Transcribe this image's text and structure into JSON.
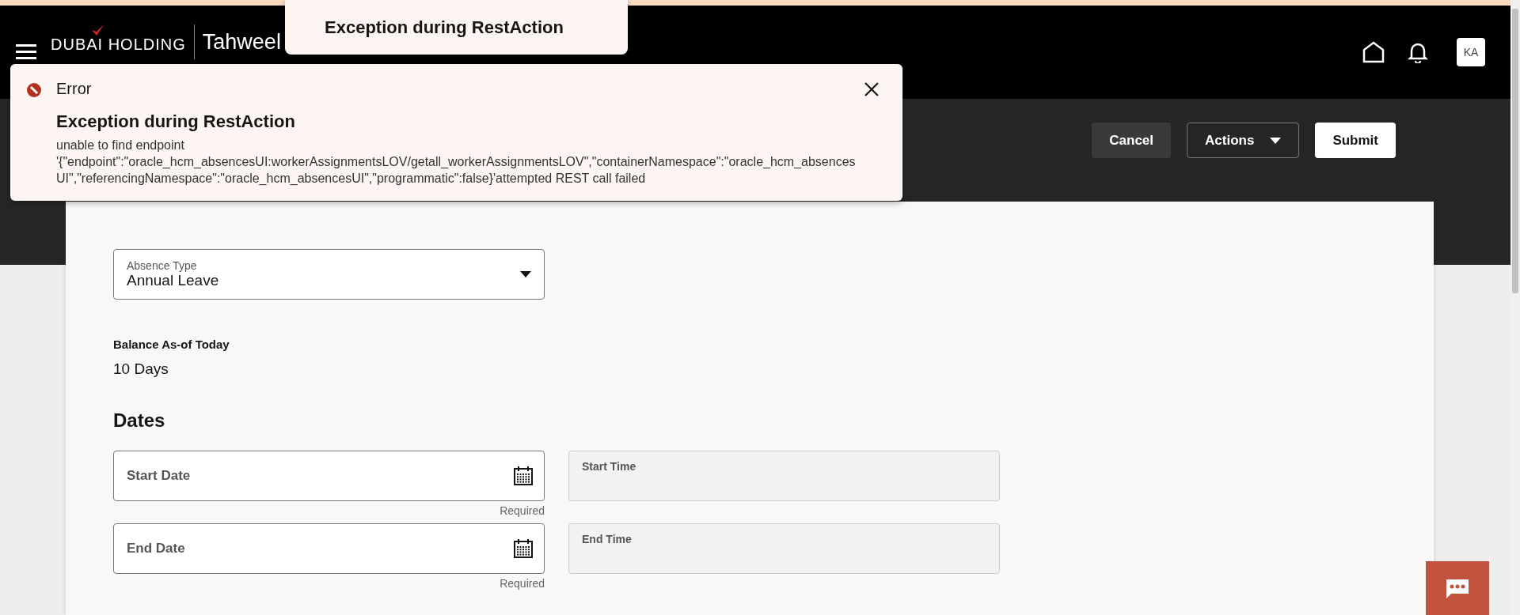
{
  "top_toast": {
    "title": "Exception during RestAction"
  },
  "header": {
    "logo": {
      "name": "DUBAI HOLDING",
      "product": "Tahweel"
    },
    "avatar": "KA"
  },
  "error_toast": {
    "label": "Error",
    "title": "Exception during RestAction",
    "message": "unable to find endpoint '{\"endpoint\":\"oracle_hcm_absencesUI:workerAssignmentsLOV/getall_workerAssignmentsLOV\",\"containerNamespace\":\"oracle_hcm_absencesUI\",\"referencingNamespace\":\"oracle_hcm_absencesUI\",\"programmatic\":false}'attempted REST call failed"
  },
  "actions": [
    {
      "label": "Cancel",
      "kind": "secondary"
    },
    {
      "label": "Actions",
      "kind": "menu"
    },
    {
      "label": "Submit",
      "kind": "primary"
    }
  ],
  "form": {
    "absence_type": {
      "label": "Absence Type",
      "value": "Annual Leave"
    },
    "balance": {
      "label": "Balance As-of Today",
      "value": "10 Days"
    },
    "section": "Dates",
    "rows": [
      {
        "date": {
          "placeholder": "Start Date",
          "helper": "Required"
        },
        "time": {
          "label": "Start Time",
          "disabled": true
        }
      },
      {
        "date": {
          "placeholder": "End Date",
          "helper": "Required"
        },
        "time": {
          "label": "End Time",
          "disabled": true
        }
      }
    ]
  }
}
